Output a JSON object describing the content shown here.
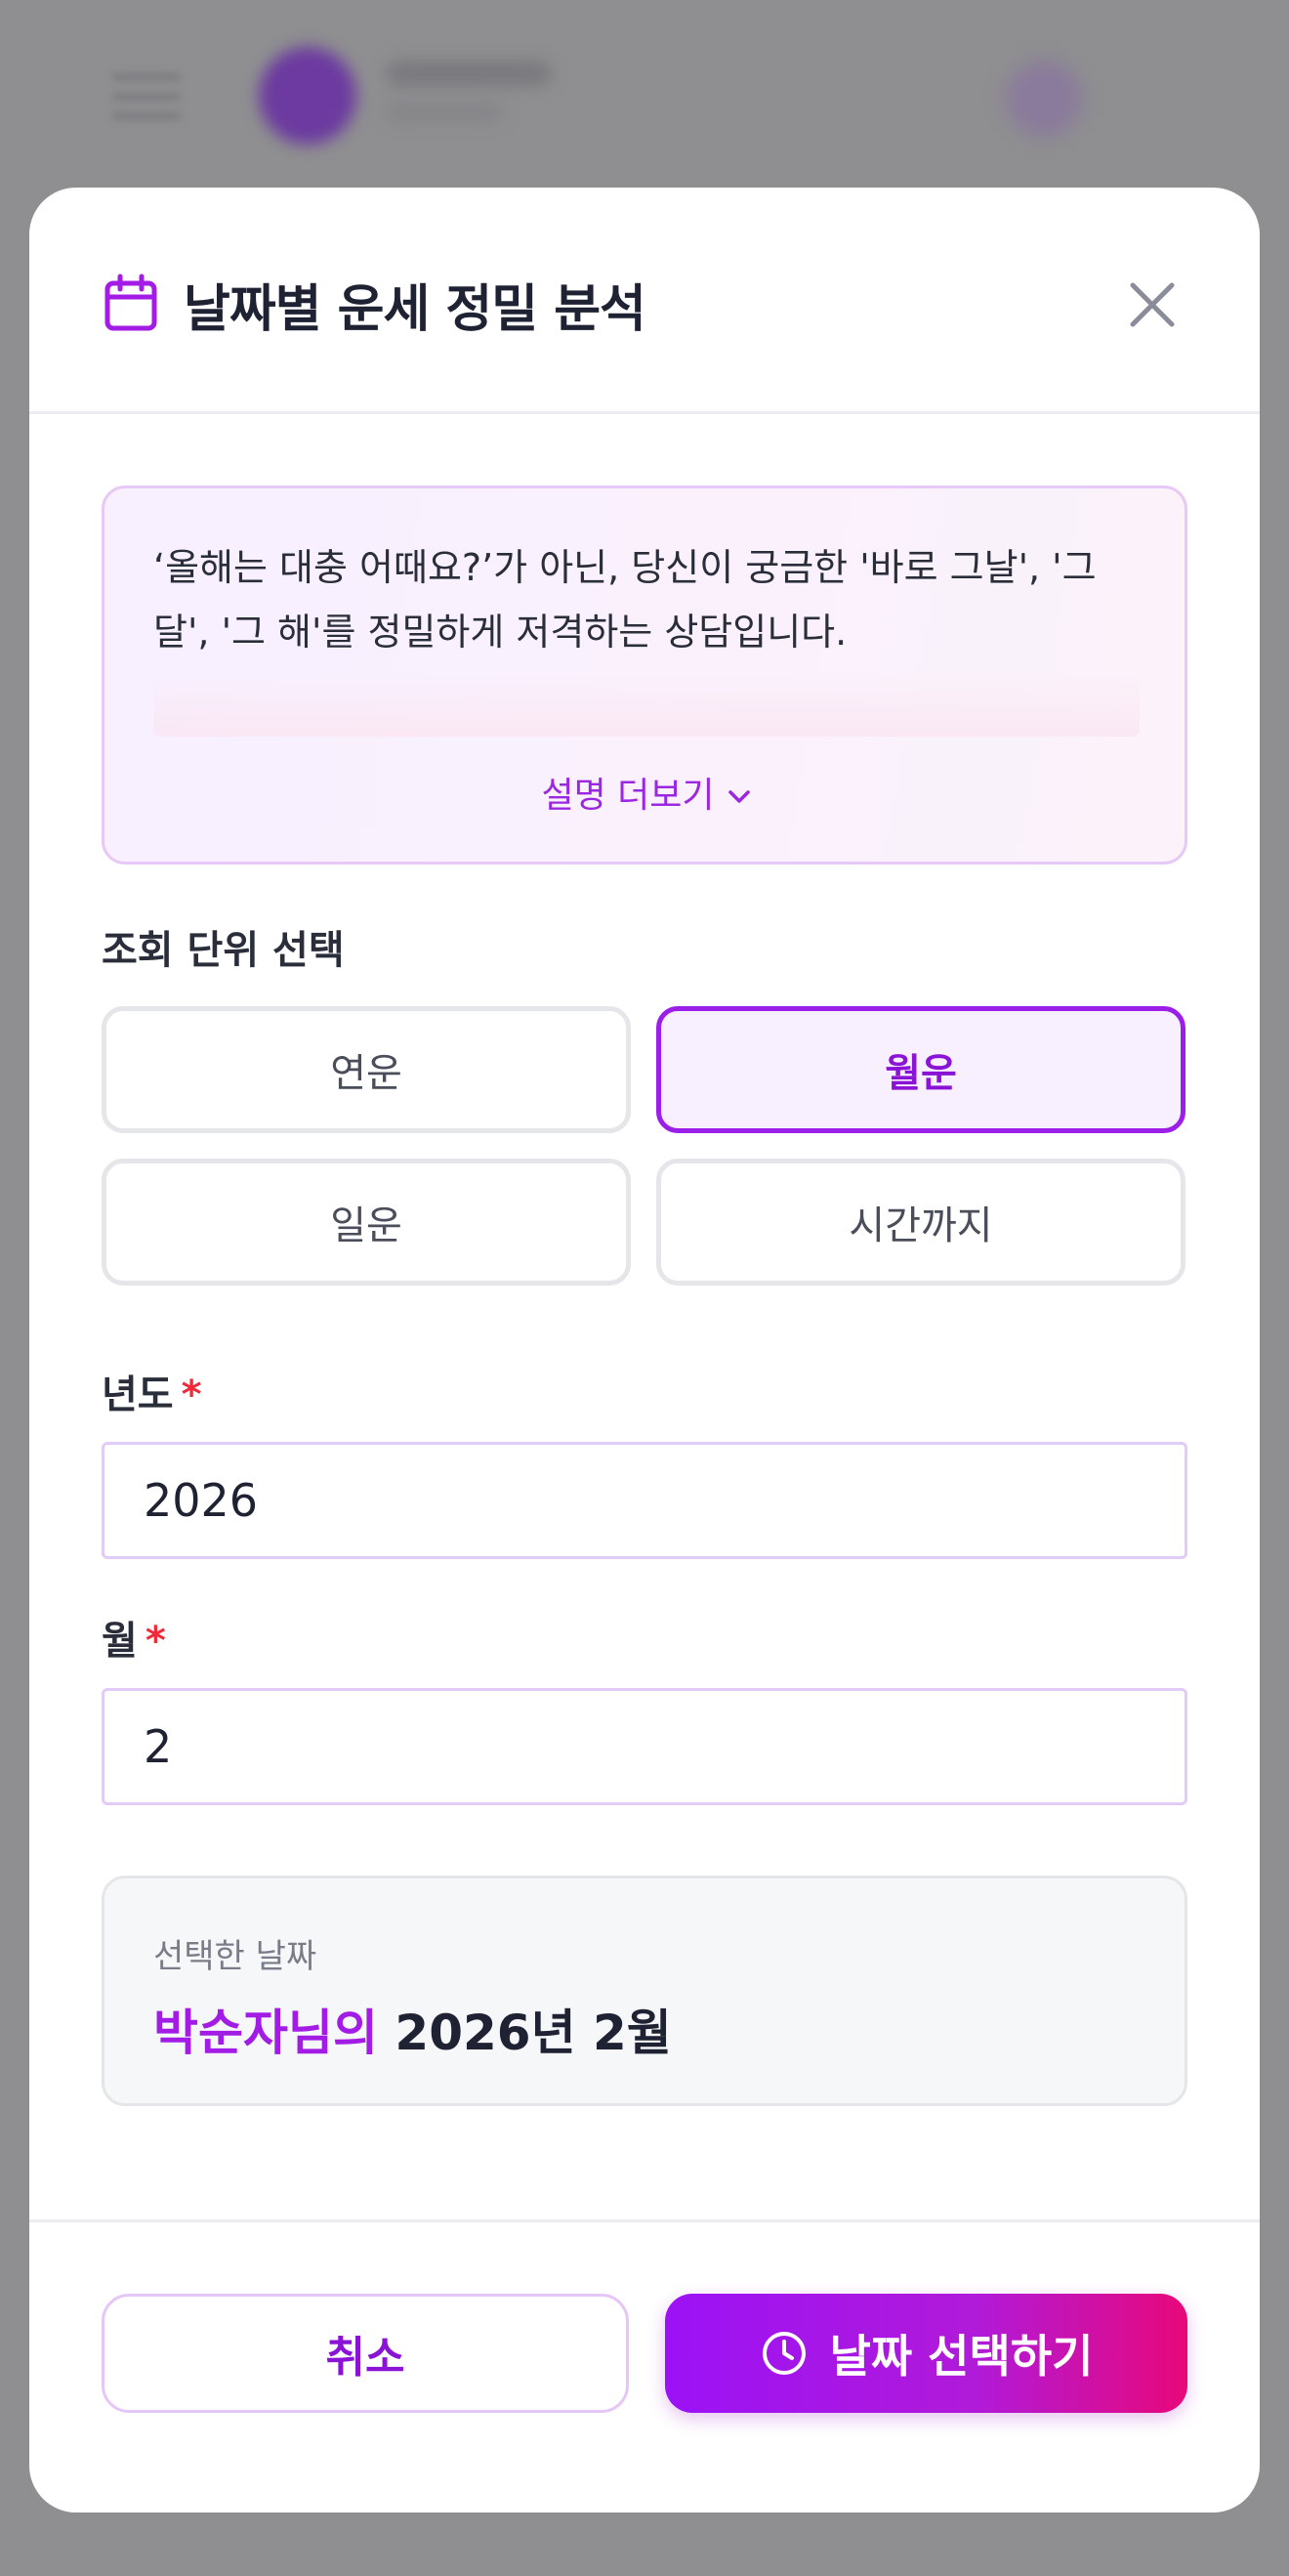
{
  "modal": {
    "title": "날짜별 운세 정밀 분석",
    "icon": "calendar-icon",
    "close_icon": "close-icon"
  },
  "info": {
    "text": "‘올해는 대충 어때요?’가 아닌, 당신이 궁금한 '바로 그날', '그 달', '그 해'를 정밀하게 저격하는 상담입니다.",
    "more_label": "설명 더보기"
  },
  "unit_select": {
    "label": "조회 단위 선택",
    "options": [
      {
        "label": "연운",
        "selected": false
      },
      {
        "label": "월운",
        "selected": true
      },
      {
        "label": "일운",
        "selected": false
      },
      {
        "label": "시간까지",
        "selected": false
      }
    ]
  },
  "fields": {
    "year": {
      "label": "년도",
      "required_mark": "*",
      "value": "2026"
    },
    "month": {
      "label": "월",
      "required_mark": "*",
      "value": "2"
    }
  },
  "summary": {
    "label": "선택한 날짜",
    "name": "박순자님의",
    "date": "2026년 2월"
  },
  "footer": {
    "cancel_label": "취소",
    "confirm_label": "날짜 선택하기",
    "confirm_icon": "clock-icon"
  },
  "colors": {
    "accent": "#9b1fe8",
    "accent_pink": "#e8087a",
    "required": "#ef2b3b",
    "overlay": "#8f8f91"
  }
}
